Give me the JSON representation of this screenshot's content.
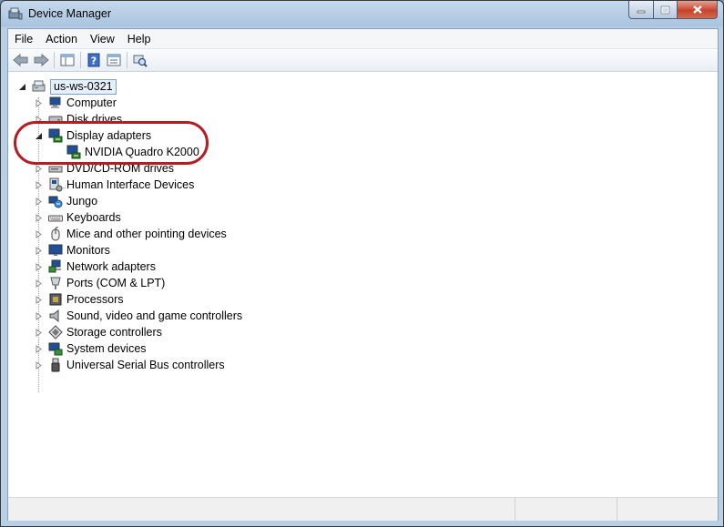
{
  "window": {
    "title": "Device Manager"
  },
  "menu": {
    "items": [
      "File",
      "Action",
      "View",
      "Help"
    ]
  },
  "toolbar": {
    "icons": [
      "back-arrow-icon",
      "forward-arrow-icon",
      "show-hide-tree-icon",
      "help-icon",
      "properties-icon",
      "scan-hardware-icon"
    ]
  },
  "tree": {
    "root": "us-ws-0321",
    "categories": [
      {
        "label": "Computer",
        "icon": "computer-icon",
        "expanded": false
      },
      {
        "label": "Disk drives",
        "icon": "disk-drive-icon",
        "expanded": false
      },
      {
        "label": "Display adapters",
        "icon": "display-adapter-icon",
        "expanded": true,
        "children": [
          "NVIDIA Quadro K2000"
        ]
      },
      {
        "label": "DVD/CD-ROM drives",
        "icon": "dvd-icon",
        "expanded": false
      },
      {
        "label": "Human Interface Devices",
        "icon": "hid-icon",
        "expanded": false
      },
      {
        "label": "Jungo",
        "icon": "jungo-icon",
        "expanded": false
      },
      {
        "label": "Keyboards",
        "icon": "keyboard-icon",
        "expanded": false
      },
      {
        "label": "Mice and other pointing devices",
        "icon": "mouse-icon",
        "expanded": false
      },
      {
        "label": "Monitors",
        "icon": "monitor-icon",
        "expanded": false
      },
      {
        "label": "Network adapters",
        "icon": "network-icon",
        "expanded": false
      },
      {
        "label": "Ports (COM & LPT)",
        "icon": "port-icon",
        "expanded": false
      },
      {
        "label": "Processors",
        "icon": "processor-icon",
        "expanded": false
      },
      {
        "label": "Sound, video and game controllers",
        "icon": "speaker-icon",
        "expanded": false
      },
      {
        "label": "Storage controllers",
        "icon": "storage-icon",
        "expanded": false
      },
      {
        "label": "System devices",
        "icon": "system-icon",
        "expanded": false
      },
      {
        "label": "Universal Serial Bus controllers",
        "icon": "usb-icon",
        "expanded": false
      }
    ]
  },
  "annotation_color": "#b31d24"
}
